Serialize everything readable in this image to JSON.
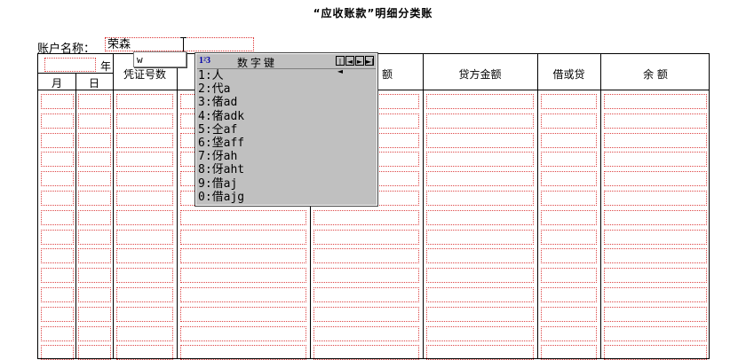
{
  "title": "“应收账款”明细分类账",
  "account": {
    "label": "账户名称：",
    "value": "荣森"
  },
  "year_label": "年",
  "headers": {
    "month": "月",
    "day": "日",
    "voucher": "凭证号数",
    "debit_partial": "额",
    "credit": "贷方金额",
    "dc": "借或贷",
    "balance": "余 额"
  },
  "ime": {
    "composition": "w",
    "logo": "1²3",
    "title": "数字键",
    "nav": [
      "|◄",
      "◄",
      "►",
      "►|"
    ],
    "candidates": [
      "1:人",
      "2:代a",
      "3:偖ad",
      "4:偖adk",
      "5:仝af",
      "6:垡aff",
      "7:伢ah",
      "8:伢aht",
      "9:借aj",
      "0:借ajg"
    ]
  }
}
